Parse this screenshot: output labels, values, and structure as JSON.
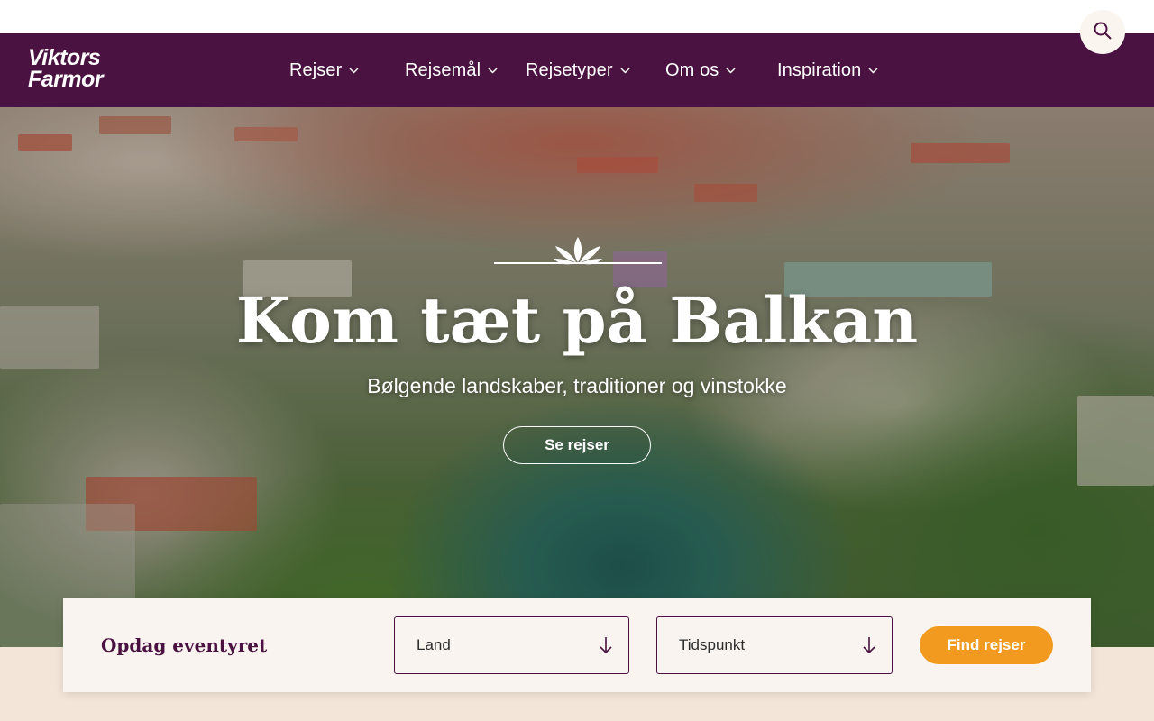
{
  "brand": {
    "logo_line1": "Viktors",
    "logo_line2": "Farmor"
  },
  "nav": {
    "items": [
      {
        "label": "Rejser"
      },
      {
        "label": "Rejsemål"
      },
      {
        "label": "Rejsetyper"
      },
      {
        "label": "Om os"
      },
      {
        "label": "Inspiration"
      }
    ]
  },
  "hero": {
    "title": "Kom tæt på Balkan",
    "subtitle": "Bølgende landskaber, traditioner og vinstokke",
    "cta_label": "Se rejser"
  },
  "search": {
    "title": "Opdag eventyret",
    "country_placeholder": "Land",
    "time_placeholder": "Tidspunkt",
    "submit_label": "Find rejser"
  },
  "colors": {
    "brand_purple": "#4a1240",
    "accent_orange": "#f29a1f",
    "panel_bg": "#f9f4ef",
    "page_bg": "#f3e6d8"
  },
  "icons": {
    "search": "search-icon",
    "chevron": "chevron-down-icon",
    "select_arrow": "arrow-down-icon",
    "emblem": "leaf-emblem-icon"
  }
}
